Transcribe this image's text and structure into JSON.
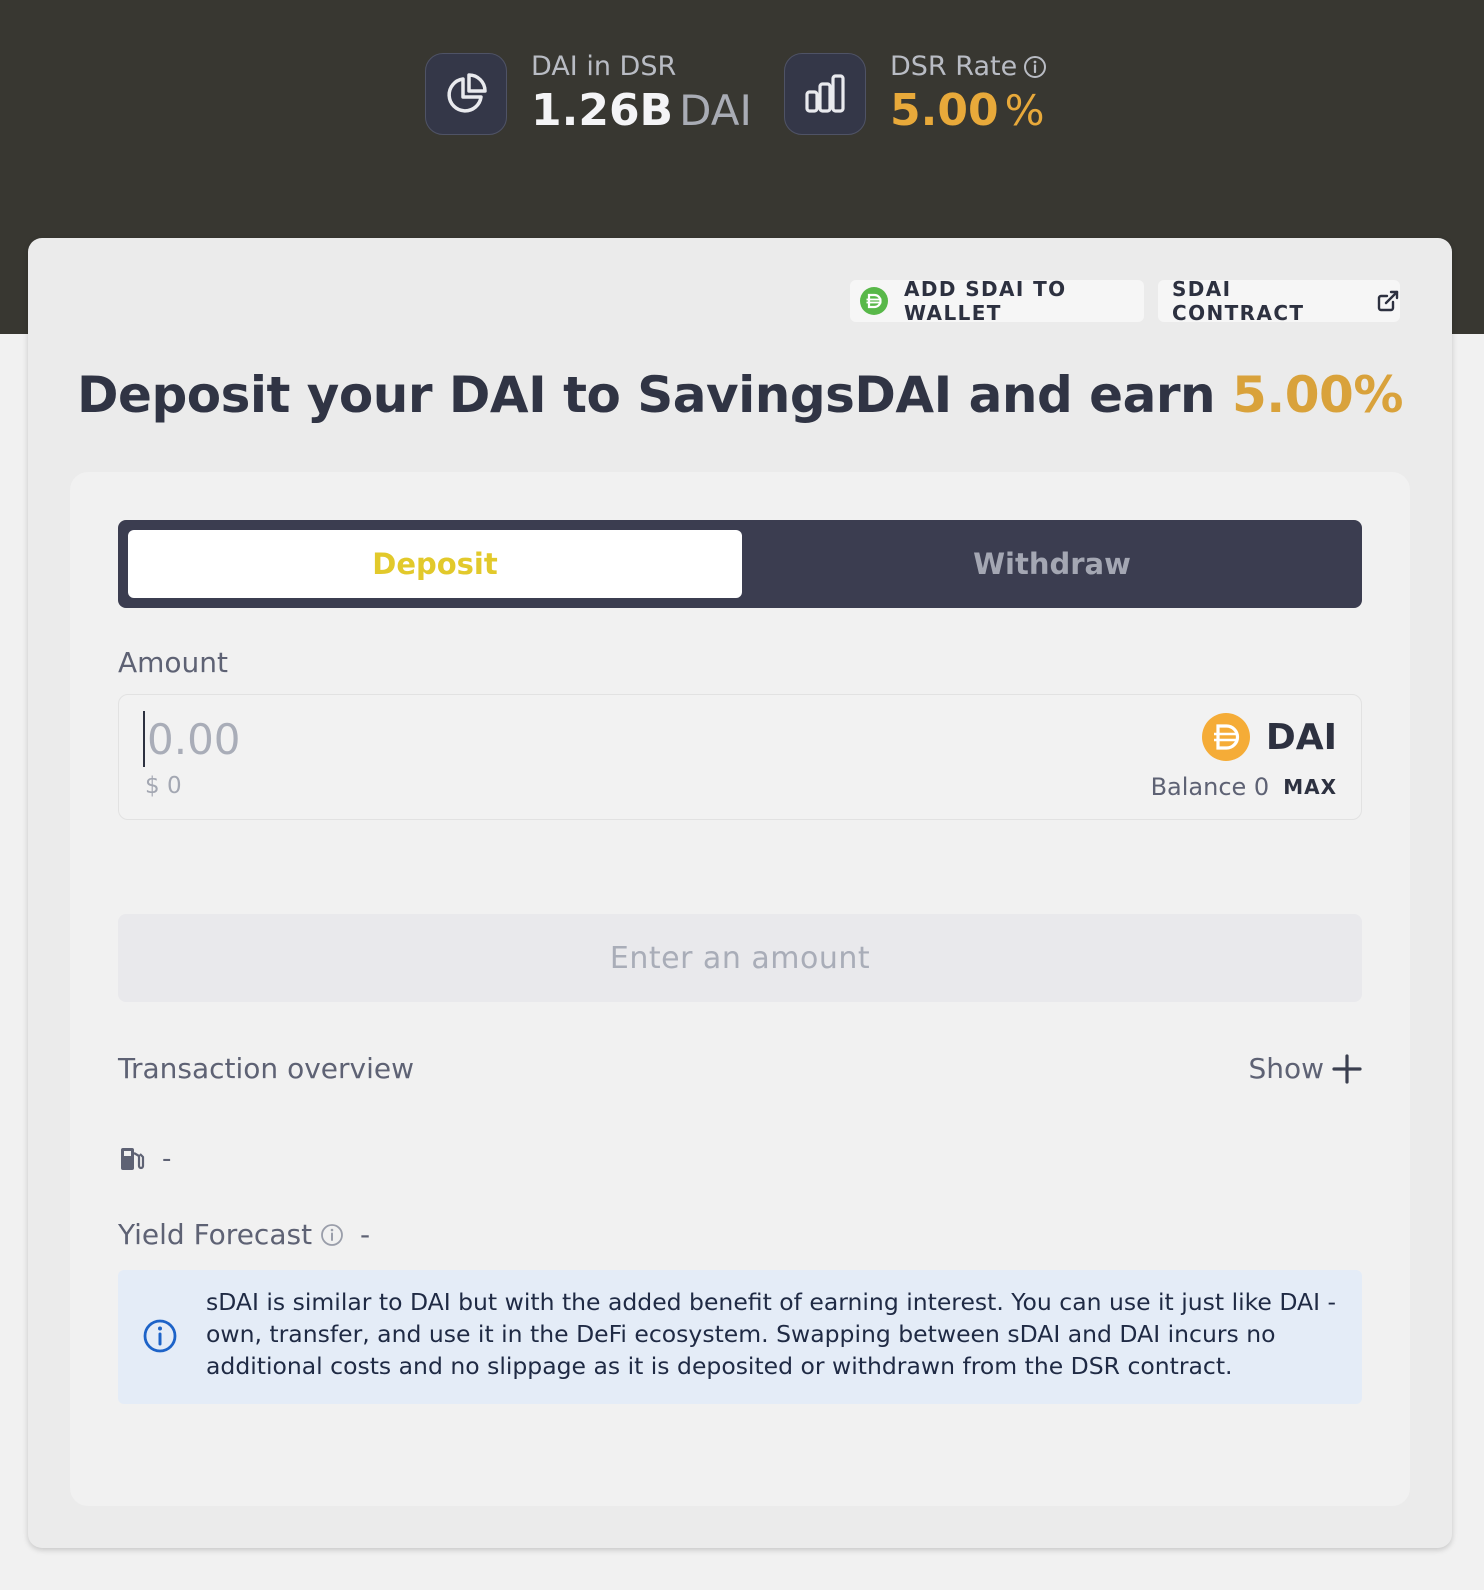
{
  "stats": {
    "dai_in_dsr": {
      "label": "DAI in DSR",
      "value": "1.26B",
      "unit": "DAI",
      "icon": "pie-chart-icon"
    },
    "dsr_rate": {
      "label": "DSR Rate",
      "value": "5.00",
      "unit": "%",
      "icon": "bar-chart-icon",
      "accent": "#e8a93a"
    }
  },
  "actions": {
    "add_to_wallet": "ADD SDAI TO WALLET",
    "contract": "SDAI CONTRACT"
  },
  "headline": {
    "text": "Deposit your DAI to SavingsDAI and earn ",
    "rate": "5.00%"
  },
  "tabs": {
    "deposit": "Deposit",
    "withdraw": "Withdraw",
    "active": "Deposit"
  },
  "amount": {
    "label": "Amount",
    "placeholder": "0.00",
    "usd": "$ 0",
    "token": "DAI",
    "balance": "Balance 0",
    "max": "MAX"
  },
  "cta": "Enter an amount",
  "overview": {
    "label": "Transaction overview",
    "toggle": "Show"
  },
  "gas": {
    "value": "-",
    "icon": "gas-pump-icon"
  },
  "yield": {
    "label": "Yield Forecast",
    "value": "-"
  },
  "info": {
    "text": "sDAI is similar to DAI but with the added benefit of earning interest. You can use it just like DAI - own, transfer, and use it in the DeFi ecosystem. Swapping between sDAI and DAI incurs no additional costs and no slippage as it is deposited or withdrawn from the DSR contract."
  },
  "colors": {
    "header_bg": "#383731",
    "accent_gold": "#e8a93a",
    "deposit_tab_text": "#e2c92b",
    "dai_token": "#f5ac37",
    "sdai_green": "#58b849",
    "info_blue": "#1d63c8"
  }
}
